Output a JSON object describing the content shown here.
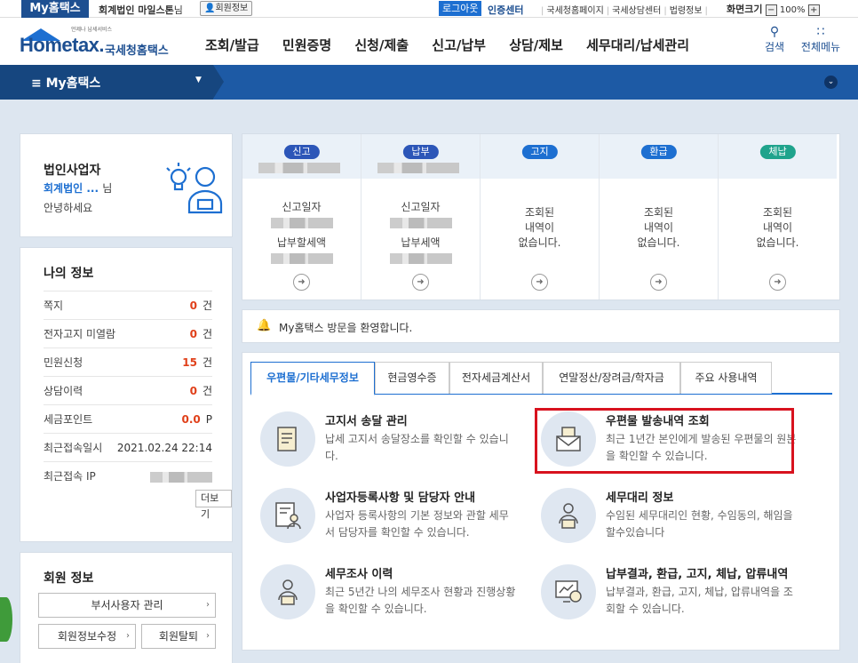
{
  "topbar": {
    "brand": "My홈택스",
    "user_org": "회계법인 마일스톤",
    "user_suffix": "님",
    "member_info_btn": "회원정보",
    "logout": "로그아웃",
    "cert_center": "인증센터",
    "links": [
      "국세청홈페이지",
      "국세상담센터",
      "법령정보"
    ],
    "zoom_label": "화면크기",
    "zoom_value": "100%",
    "zoom_minus": "−",
    "zoom_plus": "+"
  },
  "header": {
    "logo_small": "언제나 납세서비스",
    "logo_main": "Hometax.",
    "logo_sub": "국세청홈택스",
    "nav": [
      "조회/발급",
      "민원증명",
      "신청/제출",
      "신고/납부",
      "상담/제보",
      "세무대리/납세관리"
    ],
    "search": "검색",
    "all_menu": "전체메뉴"
  },
  "mynav": {
    "title": "My홈택스"
  },
  "user_panel": {
    "role": "법인사업자",
    "corp_name": "회계법인 ...",
    "corp_suffix": "님",
    "greeting": "안녕하세요"
  },
  "my_info": {
    "title": "나의 정보",
    "rows": [
      {
        "label": "쪽지",
        "value": "0",
        "unit": "건"
      },
      {
        "label": "전자고지 미열람",
        "value": "0",
        "unit": "건"
      },
      {
        "label": "민원신청",
        "value": "15",
        "unit": "건"
      },
      {
        "label": "상담이력",
        "value": "0",
        "unit": "건"
      },
      {
        "label": "세금포인트",
        "value": "0.0",
        "unit": "P"
      }
    ],
    "last_login_label": "최근접속일시",
    "last_login_value": "2021.02.24 22:14",
    "last_ip_label": "최근접속 IP",
    "more": "더보기"
  },
  "member": {
    "title": "회원 정보",
    "dept_mgmt": "부서사용자 관리",
    "edit": "회원정보수정",
    "withdraw": "회원탈퇴"
  },
  "status": {
    "columns": [
      {
        "pill": "신고",
        "color": "#2c56b8",
        "line1": "신고일자",
        "line2": "납부할세액"
      },
      {
        "pill": "납부",
        "color": "#2c56b8",
        "line1": "신고일자",
        "line2": "납부세액"
      },
      {
        "pill": "고지",
        "color": "#1d6fd1",
        "empty": "조회된\n내역이\n없습니다."
      },
      {
        "pill": "환급",
        "color": "#1d6fd1",
        "empty": "조회된\n내역이\n없습니다."
      },
      {
        "pill": "체납",
        "color": "#1fa38c",
        "empty": "조회된\n내역이\n없습니다."
      }
    ]
  },
  "welcome": {
    "text": "My홈택스 방문을 환영합니다."
  },
  "tabs": [
    "우편물/기타세무정보",
    "현금영수증",
    "전자세금계산서",
    "연말정산/장려금/학자금",
    "주요 사용내역"
  ],
  "services": [
    {
      "title": "고지서 송달 관리",
      "desc": "납세 고지서 송달장소를 확인할 수 있습니다."
    },
    {
      "title": "우편물 발송내역 조회",
      "desc": "최근 1년간 본인에게 발송된 우편물의 원본을 확인할 수 있습니다."
    },
    {
      "title": "사업자등록사항 및 담당자 안내",
      "desc": "사업자 등록사항의 기본 정보와 관할 세무서 담당자를 확인할 수 있습니다."
    },
    {
      "title": "세무대리 정보",
      "desc": "수임된 세무대리인 현황, 수임동의, 해임을 할수있습니다"
    },
    {
      "title": "세무조사 이력",
      "desc": "최근 5년간 나의 세무조사 현황과 진행상황을 확인할 수 있습니다."
    },
    {
      "title": "납부결과, 환급, 고지, 체납, 압류내역",
      "desc": "납부결과, 환급, 고지, 체납, 압류내역을 조회할 수 있습니다."
    }
  ]
}
